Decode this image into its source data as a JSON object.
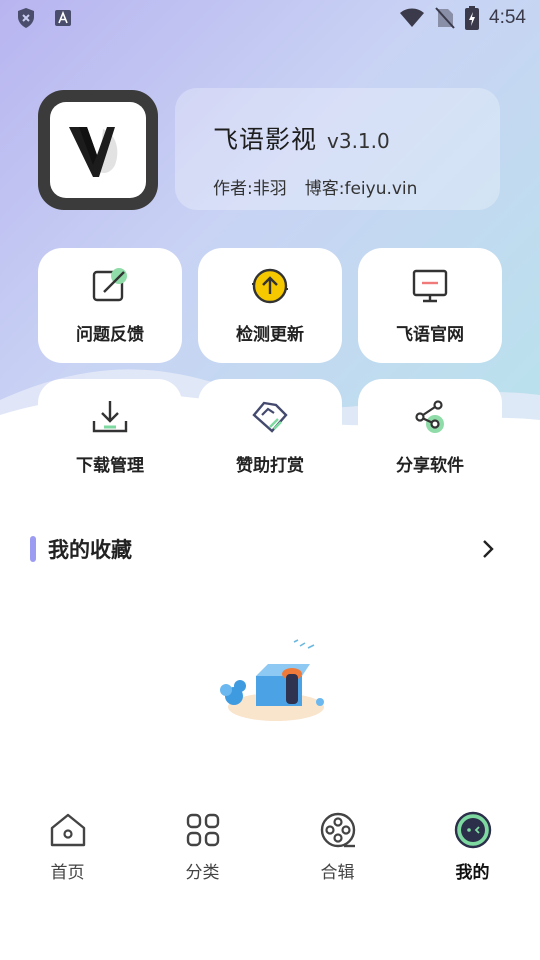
{
  "status_bar": {
    "time": "4:54"
  },
  "profile": {
    "app_name": "飞语影视",
    "version": "v3.1.0",
    "author": "作者:非羽",
    "blog": "博客:feiyu.vin"
  },
  "actions": [
    {
      "label": "问题反馈",
      "icon": "feedback-icon"
    },
    {
      "label": "检测更新",
      "icon": "update-icon"
    },
    {
      "label": "飞语官网",
      "icon": "website-icon"
    },
    {
      "label": "下载管理",
      "icon": "download-icon"
    },
    {
      "label": "赞助打赏",
      "icon": "sponsor-icon"
    },
    {
      "label": "分享软件",
      "icon": "share-icon"
    }
  ],
  "favorites": {
    "title": "我的收藏"
  },
  "bottom_nav": [
    {
      "label": "首页",
      "icon": "home-icon"
    },
    {
      "label": "分类",
      "icon": "category-icon"
    },
    {
      "label": "合辑",
      "icon": "collection-icon"
    },
    {
      "label": "我的",
      "icon": "profile-icon",
      "active": true
    }
  ],
  "colors": {
    "accent": "#9c9cf2",
    "green": "#7dd9a0",
    "yellow": "#f6c800"
  }
}
